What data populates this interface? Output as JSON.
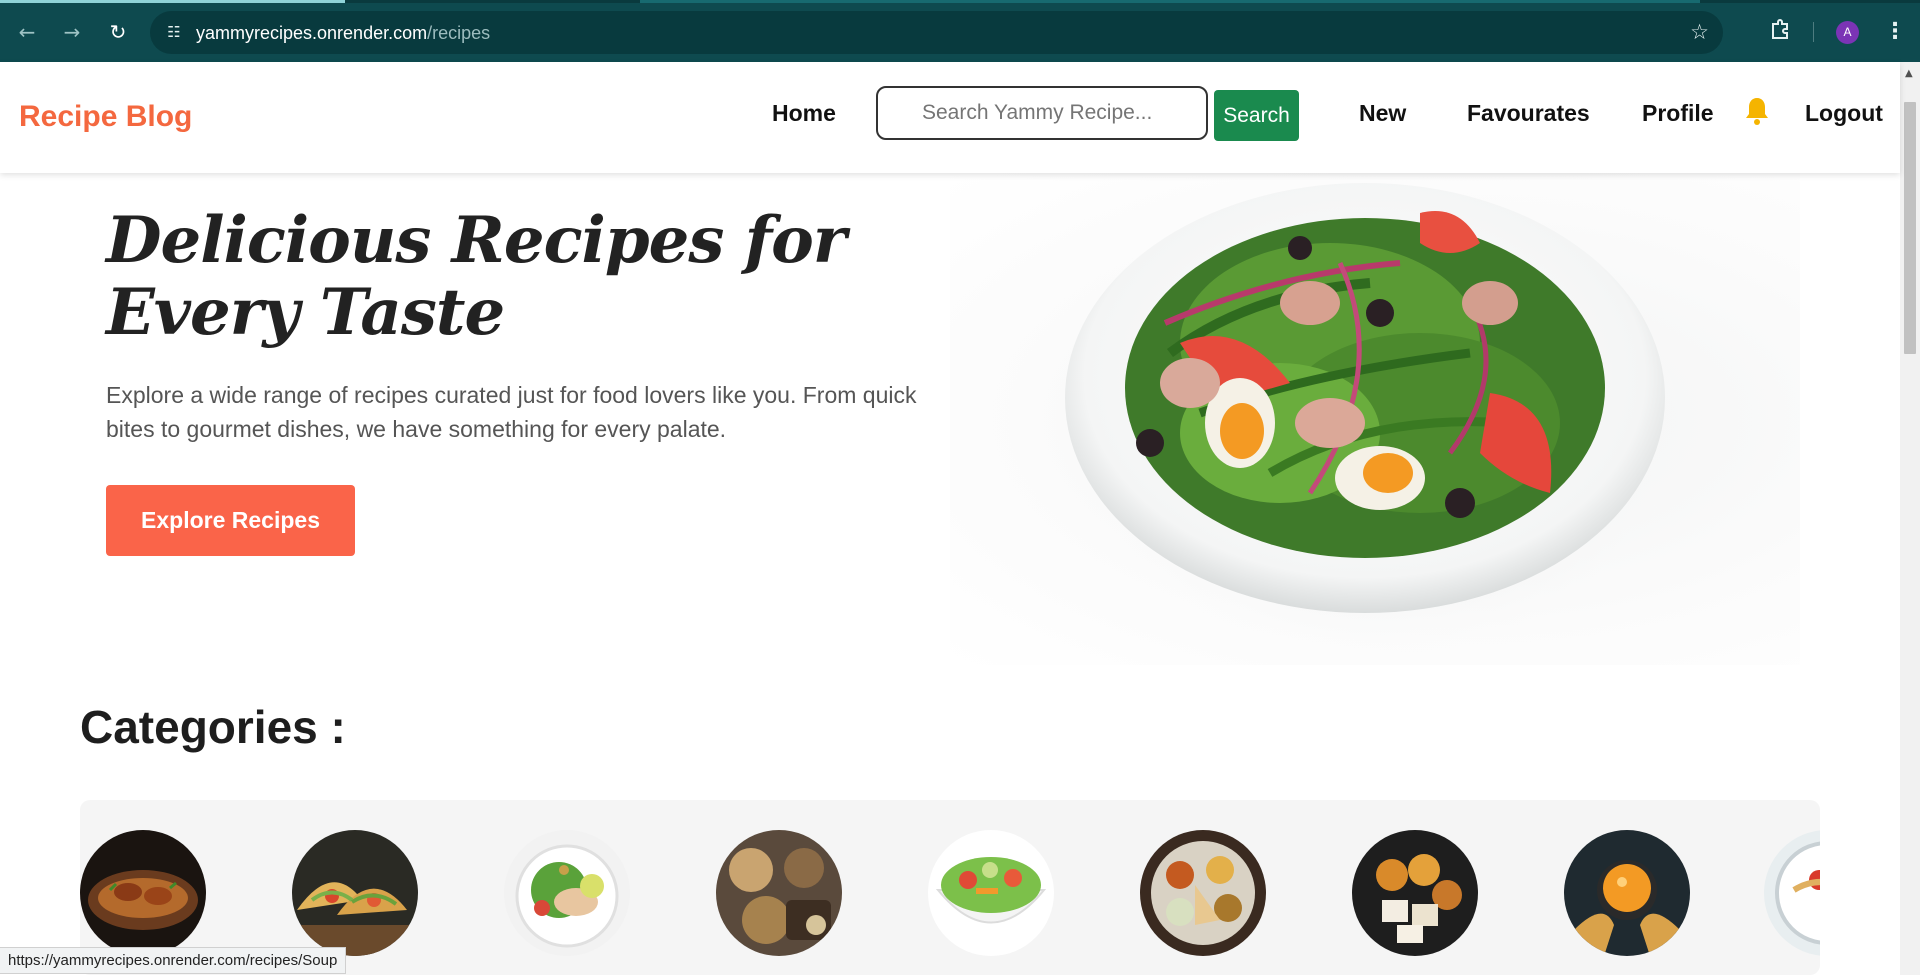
{
  "browser": {
    "url_host": "yammyrecipes.onrender.com",
    "url_path": "/recipes",
    "profile_initial": "A",
    "status_url": "https://yammyrecipes.onrender.com/recipes/Soup"
  },
  "header": {
    "brand": "Recipe Blog",
    "nav": {
      "home": "Home",
      "new": "New",
      "favourites": "Favourates",
      "profile": "Profile",
      "logout": "Logout"
    },
    "search": {
      "placeholder": "Search Yammy Recipe...",
      "button_label": "Search"
    }
  },
  "hero": {
    "title": "Delicious Recipes for Every Taste",
    "text": "Explore a wide range of recipes curated just for food lovers like you. From quick bites to gourmet dishes, we have something for every palate.",
    "button_label": "Explore Recipes"
  },
  "categories": {
    "title": "Categories :"
  },
  "colors": {
    "brand": "#f4683f",
    "accent_button": "#fa6449",
    "search_button": "#1a8a4e",
    "browser_chrome": "#0e4a4f"
  }
}
